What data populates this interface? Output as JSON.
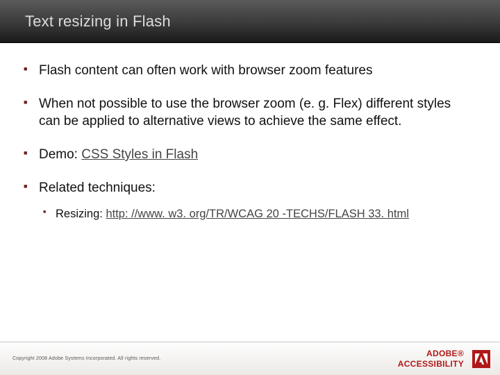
{
  "header": {
    "title": "Text resizing in Flash"
  },
  "bullets": {
    "b1": "Flash content can often work with browser zoom features",
    "b2": "When not possible to use the browser zoom (e. g. Flex) different styles can be applied to alternative views to achieve the same effect.",
    "b3_prefix": "Demo: ",
    "b3_link": "CSS Styles in Flash",
    "b4": "Related techniques:",
    "sub1_prefix": "Resizing: ",
    "sub1_link": "http: //www. w3. org/TR/WCAG 20 -TECHS/FLASH 33. html"
  },
  "footer": {
    "copyright": "Copyright 2008 Adobe Systems Incorporated.  All rights reserved.",
    "brand_line1": "ADOBE®",
    "brand_line2": "ACCESSIBILITY"
  }
}
